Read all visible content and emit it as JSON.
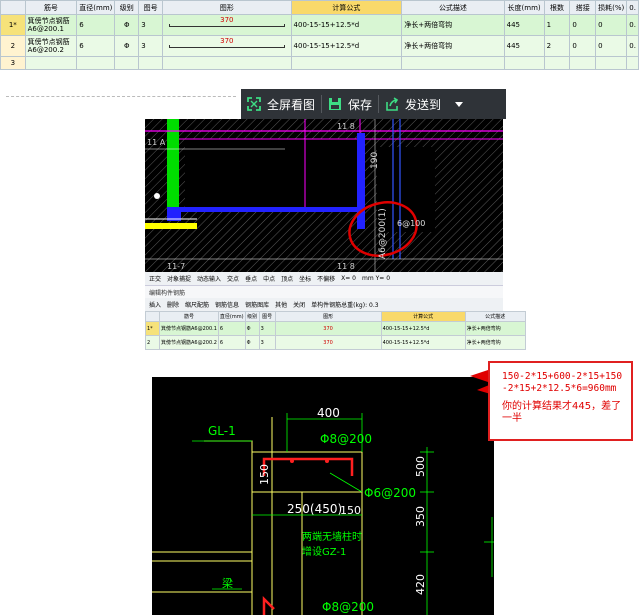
{
  "table": {
    "headers": [
      "",
      "筋号",
      "直径(mm)",
      "级别",
      "图号",
      "图形",
      "计算公式",
      "公式描述",
      "长度(mm)",
      "根数",
      "搭接",
      "损耗(%)",
      "0."
    ],
    "rows": [
      {
        "idx": "1*",
        "name": "箕傍节点钢筋A6@200.1",
        "dia": "6",
        "grade": "Φ",
        "fig": "3",
        "shape_len": "370",
        "formula": "400-15-15+12.5*d",
        "desc": "净长+两倍弯钩",
        "len": "445",
        "count": "1",
        "lap": "0",
        "loss": "0",
        "extra": "0."
      },
      {
        "idx": "2",
        "name": "箕傍节点钢筋A6@200.2",
        "dia": "6",
        "grade": "Φ",
        "fig": "3",
        "shape_len": "370",
        "formula": "400-15-15+12.5*d",
        "desc": "净长+两倍弯钩",
        "len": "445",
        "count": "2",
        "lap": "0",
        "loss": "0",
        "extra": "0."
      },
      {
        "idx": "3",
        "name": "",
        "dia": "",
        "grade": "",
        "fig": "",
        "shape_len": "",
        "formula": "",
        "desc": "",
        "len": "",
        "count": "",
        "lap": "",
        "loss": "",
        "extra": ""
      }
    ]
  },
  "separator_dots": "...",
  "viewer_toolbar": {
    "fullscreen": "全屏看图",
    "save": "保存",
    "send": "发送到"
  },
  "cad1": {
    "labels": {
      "a": "11 A",
      "b": "11 8",
      "c": "11-7",
      "d": "11 8",
      "rebar": "A6@200(1)",
      "n1": "190",
      "n2": "6@100"
    }
  },
  "mini_toolbar": {
    "items": [
      "正交",
      "对象捕捉",
      "动态输入",
      "交点",
      "垂点",
      "中点",
      "顶点",
      "坐标",
      "不偏移",
      "X= 0",
      "mm Y= 0"
    ],
    "title": "编辑构件钢筋",
    "actions": [
      "插入",
      "删除",
      "缩尺配筋",
      "钢筋信息",
      "钢筋图库",
      "其他",
      "关闭",
      "单构件钢筋总重(kg): 0.3"
    ]
  },
  "mini_table": {
    "headers": [
      "",
      "筋号",
      "直径(mm)",
      "级别",
      "图号",
      "图形",
      "计算公式",
      "公式描述"
    ],
    "rows": [
      {
        "idx": "1*",
        "name": "箕傍节点钢筋A6@200.1",
        "dia": "6",
        "grade": "Φ",
        "fig": "3",
        "shape_len": "370",
        "formula": "400-15-15+12.5*d",
        "desc": "净长+两倍弯钩"
      },
      {
        "idx": "2",
        "name": "箕傍节点钢筋A6@200.2",
        "dia": "6",
        "grade": "Φ",
        "fig": "3",
        "shape_len": "370",
        "formula": "400-15-15+12.5*d",
        "desc": "净长+两倍弯钩"
      }
    ]
  },
  "callout": {
    "formula": "150-2*15+600-2*15+150-2*15+2*12.5*6=960mm",
    "comment": "你的计算结果才445，差了一半"
  },
  "cad2": {
    "gl": "GL-1",
    "dim_top": "400",
    "rebar_top": "Φ8@200",
    "dim_left": "150",
    "dim_right": "500",
    "rebar_mid": "Φ6@200",
    "dim_bot": "250(450)",
    "dim_bot2": "150",
    "note1": "两端无墙柱时",
    "note2": "增设GZ-1",
    "dim_v": "350",
    "beam": "梁",
    "dim_v2": "420",
    "rebar_bot": "Φ8@200"
  },
  "colors": {
    "accent_red": "#e00000",
    "row_green": "#d8f6d3",
    "header_yellow": "#f9d96a",
    "toolbar_dark": "#2f3338",
    "cad_green": "#00ff00",
    "cad_magenta": "#ff00ff"
  },
  "icons": [
    "fullscreen-icon",
    "save-icon",
    "send-icon",
    "dropdown-icon"
  ]
}
